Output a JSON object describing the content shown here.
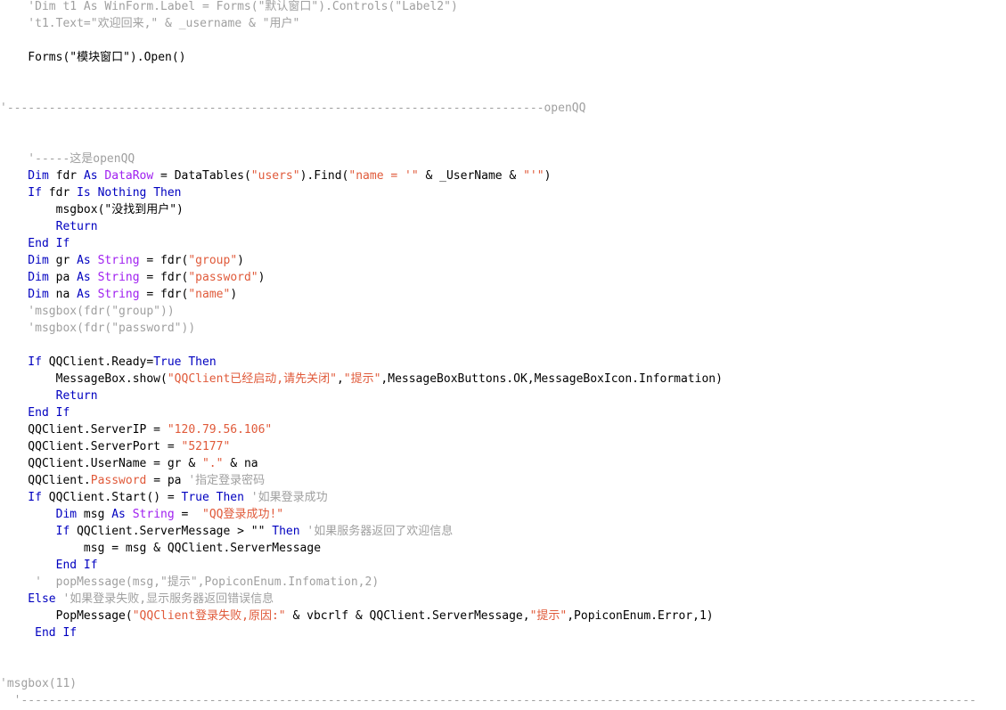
{
  "colors": {
    "keyword": "#0000c0",
    "type": "#a020f0",
    "string": "#e05a3a",
    "comment": "#a0a0a0",
    "text": "#000000",
    "background": "#ffffff"
  },
  "code": {
    "l1": [
      [
        "c",
        "    'Dim t1 As WinForm.Label = Forms(\"默认窗口\").Controls(\"Label2\")"
      ]
    ],
    "l2": [
      [
        "c",
        "    't1.Text=\"欢迎回来,\" & _username & \"用户\""
      ]
    ],
    "l4": [
      [
        "n",
        "    Forms(\"模块窗口\").Open()"
      ]
    ],
    "l7": [
      [
        "c",
        "'-----------------------------------------------------------------------------openQQ"
      ]
    ],
    "l10": [
      [
        "c",
        "    '-----这是openQQ"
      ]
    ],
    "l11": [
      [
        "k",
        "    Dim"
      ],
      [
        "n",
        " fdr "
      ],
      [
        "k",
        "As"
      ],
      [
        "t",
        " DataRow"
      ],
      [
        "n",
        " = DataTables("
      ],
      [
        "s",
        "\"users\""
      ],
      [
        "n",
        ").Find("
      ],
      [
        "s",
        "\"name = '\""
      ],
      [
        "n",
        " & _UserName & "
      ],
      [
        "s",
        "\"'\""
      ],
      [
        "n",
        ")"
      ]
    ],
    "l12": [
      [
        "k",
        "    If"
      ],
      [
        "n",
        " fdr "
      ],
      [
        "k",
        "Is Nothing Then"
      ]
    ],
    "l13": [
      [
        "n",
        "        msgbox(\"没找到用户\")"
      ]
    ],
    "l14": [
      [
        "k",
        "        Return"
      ]
    ],
    "l15": [
      [
        "k",
        "    End If"
      ]
    ],
    "l16": [
      [
        "k",
        "    Dim"
      ],
      [
        "n",
        " gr "
      ],
      [
        "k",
        "As"
      ],
      [
        "t",
        " String"
      ],
      [
        "n",
        " = fdr("
      ],
      [
        "s",
        "\"group\""
      ],
      [
        "n",
        ")"
      ]
    ],
    "l17": [
      [
        "k",
        "    Dim"
      ],
      [
        "n",
        " pa "
      ],
      [
        "k",
        "As"
      ],
      [
        "t",
        " String"
      ],
      [
        "n",
        " = fdr("
      ],
      [
        "s",
        "\"password\""
      ],
      [
        "n",
        ")"
      ]
    ],
    "l18": [
      [
        "k",
        "    Dim"
      ],
      [
        "n",
        " na "
      ],
      [
        "k",
        "As"
      ],
      [
        "t",
        " String"
      ],
      [
        "n",
        " = fdr("
      ],
      [
        "s",
        "\"name\""
      ],
      [
        "n",
        ")"
      ]
    ],
    "l19": [
      [
        "c",
        "    'msgbox(fdr(\"group\"))"
      ]
    ],
    "l20": [
      [
        "c",
        "    'msgbox(fdr(\"password\"))"
      ]
    ],
    "l22": [
      [
        "k",
        "    If"
      ],
      [
        "n",
        " QQClient.Ready="
      ],
      [
        "k",
        "True Then"
      ]
    ],
    "l23": [
      [
        "n",
        "        MessageBox.show("
      ],
      [
        "s",
        "\"QQClient已经启动,请先关闭\""
      ],
      [
        "n",
        ","
      ],
      [
        "s",
        "\"提示\""
      ],
      [
        "n",
        ",MessageBoxButtons.OK,MessageBoxIcon.Information)"
      ]
    ],
    "l24": [
      [
        "k",
        "        Return"
      ]
    ],
    "l25": [
      [
        "k",
        "    End If"
      ]
    ],
    "l26": [
      [
        "n",
        "    QQClient.ServerIP = "
      ],
      [
        "s",
        "\"120.79.56.106\""
      ]
    ],
    "l27": [
      [
        "n",
        "    QQClient.ServerPort = "
      ],
      [
        "s",
        "\"52177\""
      ]
    ],
    "l28": [
      [
        "n",
        "    QQClient.UserName = gr & "
      ],
      [
        "s",
        "\".\""
      ],
      [
        "n",
        " & na"
      ]
    ],
    "l29": [
      [
        "n",
        "    QQClient."
      ],
      [
        "s",
        "Password"
      ],
      [
        "n",
        " = pa "
      ],
      [
        "c",
        "'指定登录密码"
      ]
    ],
    "l30": [
      [
        "k",
        "    If"
      ],
      [
        "n",
        " QQClient.Start() = "
      ],
      [
        "k",
        "True Then"
      ],
      [
        "c",
        " '如果登录成功"
      ]
    ],
    "l31": [
      [
        "k",
        "        Dim"
      ],
      [
        "n",
        " msg "
      ],
      [
        "k",
        "As"
      ],
      [
        "t",
        " String"
      ],
      [
        "n",
        " =  "
      ],
      [
        "s",
        "\"QQ登录成功!\""
      ]
    ],
    "l32": [
      [
        "k",
        "        If"
      ],
      [
        "n",
        " QQClient.ServerMessage > \"\" "
      ],
      [
        "k",
        "Then"
      ],
      [
        "c",
        " '如果服务器返回了欢迎信息"
      ]
    ],
    "l33": [
      [
        "n",
        "            msg = msg & QQClient.ServerMessage"
      ]
    ],
    "l34": [
      [
        "k",
        "        End If"
      ]
    ],
    "l35": [
      [
        "c",
        "     '  popMessage(msg,\"提示\",PopiconEnum.Infomation,2)"
      ]
    ],
    "l36": [
      [
        "k",
        "    Else"
      ],
      [
        "c",
        " '如果登录失败,显示服务器返回错误信息"
      ]
    ],
    "l37": [
      [
        "n",
        "        PopMessage("
      ],
      [
        "s",
        "\"QQClient登录失败,原因:\""
      ],
      [
        "n",
        " & vbcrlf & QQClient.ServerMessage,"
      ],
      [
        "s",
        "\"提示\""
      ],
      [
        "n",
        ",PopiconEnum.Error,1)"
      ]
    ],
    "l38": [
      [
        "k",
        "     End If"
      ]
    ],
    "l41": [
      [
        "c",
        "'msgbox(11)"
      ]
    ],
    "l42": [
      [
        "c",
        "  '-----------------------------------------------------------------------------------------------------------------------------------------"
      ]
    ]
  }
}
